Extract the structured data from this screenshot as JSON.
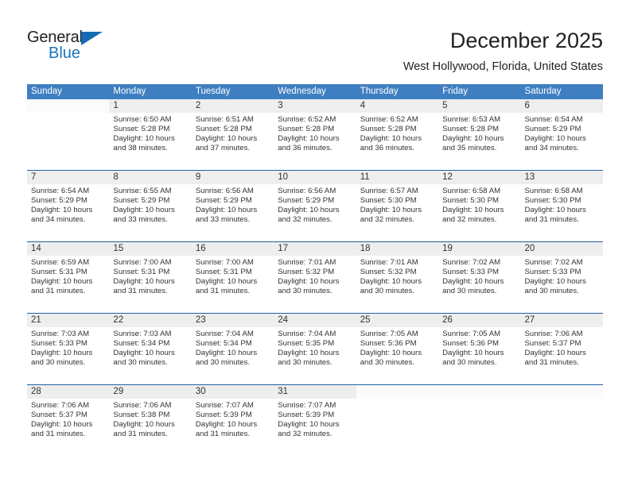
{
  "brand": {
    "name_top": "General",
    "name_bottom": "Blue",
    "accent_color": "#1b74bc"
  },
  "header": {
    "title": "December 2025",
    "subtitle": "West Hollywood, Florida, United States"
  },
  "calendar": {
    "header_bg": "#3f7fc1",
    "weekday_headers": [
      "Sunday",
      "Monday",
      "Tuesday",
      "Wednesday",
      "Thursday",
      "Friday",
      "Saturday"
    ],
    "weeks": [
      [
        {
          "day": "",
          "sunrise": "",
          "sunset": "",
          "daylight1": "",
          "daylight2": ""
        },
        {
          "day": "1",
          "sunrise": "Sunrise: 6:50 AM",
          "sunset": "Sunset: 5:28 PM",
          "daylight1": "Daylight: 10 hours",
          "daylight2": "and 38 minutes."
        },
        {
          "day": "2",
          "sunrise": "Sunrise: 6:51 AM",
          "sunset": "Sunset: 5:28 PM",
          "daylight1": "Daylight: 10 hours",
          "daylight2": "and 37 minutes."
        },
        {
          "day": "3",
          "sunrise": "Sunrise: 6:52 AM",
          "sunset": "Sunset: 5:28 PM",
          "daylight1": "Daylight: 10 hours",
          "daylight2": "and 36 minutes."
        },
        {
          "day": "4",
          "sunrise": "Sunrise: 6:52 AM",
          "sunset": "Sunset: 5:28 PM",
          "daylight1": "Daylight: 10 hours",
          "daylight2": "and 36 minutes."
        },
        {
          "day": "5",
          "sunrise": "Sunrise: 6:53 AM",
          "sunset": "Sunset: 5:28 PM",
          "daylight1": "Daylight: 10 hours",
          "daylight2": "and 35 minutes."
        },
        {
          "day": "6",
          "sunrise": "Sunrise: 6:54 AM",
          "sunset": "Sunset: 5:29 PM",
          "daylight1": "Daylight: 10 hours",
          "daylight2": "and 34 minutes."
        }
      ],
      [
        {
          "day": "7",
          "sunrise": "Sunrise: 6:54 AM",
          "sunset": "Sunset: 5:29 PM",
          "daylight1": "Daylight: 10 hours",
          "daylight2": "and 34 minutes."
        },
        {
          "day": "8",
          "sunrise": "Sunrise: 6:55 AM",
          "sunset": "Sunset: 5:29 PM",
          "daylight1": "Daylight: 10 hours",
          "daylight2": "and 33 minutes."
        },
        {
          "day": "9",
          "sunrise": "Sunrise: 6:56 AM",
          "sunset": "Sunset: 5:29 PM",
          "daylight1": "Daylight: 10 hours",
          "daylight2": "and 33 minutes."
        },
        {
          "day": "10",
          "sunrise": "Sunrise: 6:56 AM",
          "sunset": "Sunset: 5:29 PM",
          "daylight1": "Daylight: 10 hours",
          "daylight2": "and 32 minutes."
        },
        {
          "day": "11",
          "sunrise": "Sunrise: 6:57 AM",
          "sunset": "Sunset: 5:30 PM",
          "daylight1": "Daylight: 10 hours",
          "daylight2": "and 32 minutes."
        },
        {
          "day": "12",
          "sunrise": "Sunrise: 6:58 AM",
          "sunset": "Sunset: 5:30 PM",
          "daylight1": "Daylight: 10 hours",
          "daylight2": "and 32 minutes."
        },
        {
          "day": "13",
          "sunrise": "Sunrise: 6:58 AM",
          "sunset": "Sunset: 5:30 PM",
          "daylight1": "Daylight: 10 hours",
          "daylight2": "and 31 minutes."
        }
      ],
      [
        {
          "day": "14",
          "sunrise": "Sunrise: 6:59 AM",
          "sunset": "Sunset: 5:31 PM",
          "daylight1": "Daylight: 10 hours",
          "daylight2": "and 31 minutes."
        },
        {
          "day": "15",
          "sunrise": "Sunrise: 7:00 AM",
          "sunset": "Sunset: 5:31 PM",
          "daylight1": "Daylight: 10 hours",
          "daylight2": "and 31 minutes."
        },
        {
          "day": "16",
          "sunrise": "Sunrise: 7:00 AM",
          "sunset": "Sunset: 5:31 PM",
          "daylight1": "Daylight: 10 hours",
          "daylight2": "and 31 minutes."
        },
        {
          "day": "17",
          "sunrise": "Sunrise: 7:01 AM",
          "sunset": "Sunset: 5:32 PM",
          "daylight1": "Daylight: 10 hours",
          "daylight2": "and 30 minutes."
        },
        {
          "day": "18",
          "sunrise": "Sunrise: 7:01 AM",
          "sunset": "Sunset: 5:32 PM",
          "daylight1": "Daylight: 10 hours",
          "daylight2": "and 30 minutes."
        },
        {
          "day": "19",
          "sunrise": "Sunrise: 7:02 AM",
          "sunset": "Sunset: 5:33 PM",
          "daylight1": "Daylight: 10 hours",
          "daylight2": "and 30 minutes."
        },
        {
          "day": "20",
          "sunrise": "Sunrise: 7:02 AM",
          "sunset": "Sunset: 5:33 PM",
          "daylight1": "Daylight: 10 hours",
          "daylight2": "and 30 minutes."
        }
      ],
      [
        {
          "day": "21",
          "sunrise": "Sunrise: 7:03 AM",
          "sunset": "Sunset: 5:33 PM",
          "daylight1": "Daylight: 10 hours",
          "daylight2": "and 30 minutes."
        },
        {
          "day": "22",
          "sunrise": "Sunrise: 7:03 AM",
          "sunset": "Sunset: 5:34 PM",
          "daylight1": "Daylight: 10 hours",
          "daylight2": "and 30 minutes."
        },
        {
          "day": "23",
          "sunrise": "Sunrise: 7:04 AM",
          "sunset": "Sunset: 5:34 PM",
          "daylight1": "Daylight: 10 hours",
          "daylight2": "and 30 minutes."
        },
        {
          "day": "24",
          "sunrise": "Sunrise: 7:04 AM",
          "sunset": "Sunset: 5:35 PM",
          "daylight1": "Daylight: 10 hours",
          "daylight2": "and 30 minutes."
        },
        {
          "day": "25",
          "sunrise": "Sunrise: 7:05 AM",
          "sunset": "Sunset: 5:36 PM",
          "daylight1": "Daylight: 10 hours",
          "daylight2": "and 30 minutes."
        },
        {
          "day": "26",
          "sunrise": "Sunrise: 7:05 AM",
          "sunset": "Sunset: 5:36 PM",
          "daylight1": "Daylight: 10 hours",
          "daylight2": "and 30 minutes."
        },
        {
          "day": "27",
          "sunrise": "Sunrise: 7:06 AM",
          "sunset": "Sunset: 5:37 PM",
          "daylight1": "Daylight: 10 hours",
          "daylight2": "and 31 minutes."
        }
      ],
      [
        {
          "day": "28",
          "sunrise": "Sunrise: 7:06 AM",
          "sunset": "Sunset: 5:37 PM",
          "daylight1": "Daylight: 10 hours",
          "daylight2": "and 31 minutes."
        },
        {
          "day": "29",
          "sunrise": "Sunrise: 7:06 AM",
          "sunset": "Sunset: 5:38 PM",
          "daylight1": "Daylight: 10 hours",
          "daylight2": "and 31 minutes."
        },
        {
          "day": "30",
          "sunrise": "Sunrise: 7:07 AM",
          "sunset": "Sunset: 5:39 PM",
          "daylight1": "Daylight: 10 hours",
          "daylight2": "and 31 minutes."
        },
        {
          "day": "31",
          "sunrise": "Sunrise: 7:07 AM",
          "sunset": "Sunset: 5:39 PM",
          "daylight1": "Daylight: 10 hours",
          "daylight2": "and 32 minutes."
        },
        {
          "day": "",
          "sunrise": "",
          "sunset": "",
          "daylight1": "",
          "daylight2": ""
        },
        {
          "day": "",
          "sunrise": "",
          "sunset": "",
          "daylight1": "",
          "daylight2": ""
        },
        {
          "day": "",
          "sunrise": "",
          "sunset": "",
          "daylight1": "",
          "daylight2": ""
        }
      ]
    ]
  }
}
